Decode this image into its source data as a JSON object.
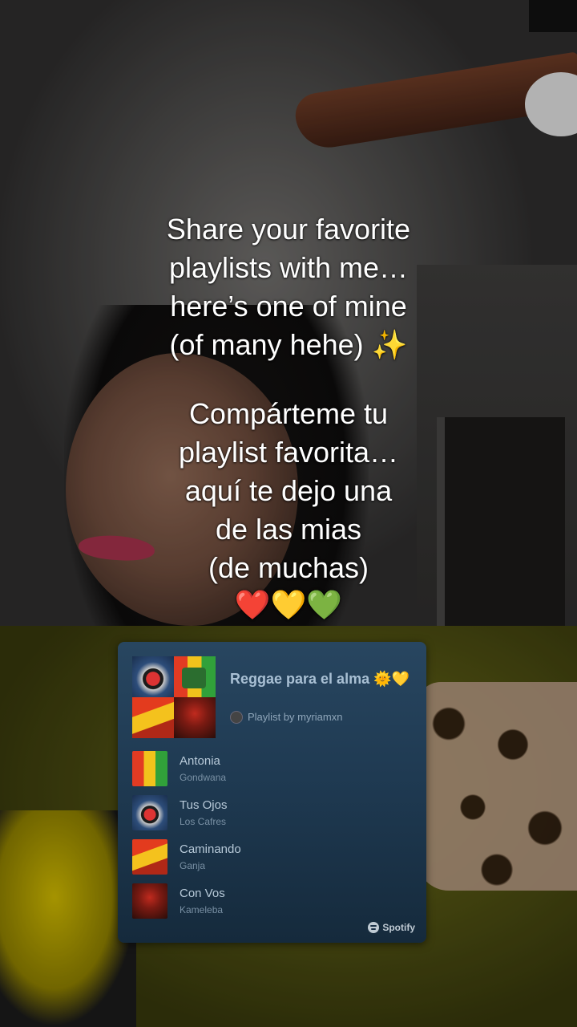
{
  "caption_en": {
    "lines": [
      "Share your favorite",
      "playlists with me…",
      "here’s one of mine",
      "(of many hehe) "
    ],
    "emoji": "✨"
  },
  "caption_es": {
    "lines": [
      "Compárteme tu",
      "playlist favorita…",
      "aquí te dejo una",
      "de las mias",
      "(de muchas)"
    ],
    "hearts": [
      "❤️",
      "💛",
      "💚"
    ]
  },
  "playlist_card": {
    "title": "Reggae para el alma 🌞💛",
    "byline": "Playlist by myriamxn",
    "brand": "Spotify",
    "tracks": [
      {
        "title": "Antonia",
        "artist": "Gondwana"
      },
      {
        "title": "Tus Ojos",
        "artist": "Los Cafres"
      },
      {
        "title": "Caminando",
        "artist": "Ganja"
      },
      {
        "title": "Con Vos",
        "artist": "Kameleba"
      }
    ]
  },
  "colors": {
    "card_bg": "#1f3a52",
    "caption_text": "#ffffff"
  }
}
